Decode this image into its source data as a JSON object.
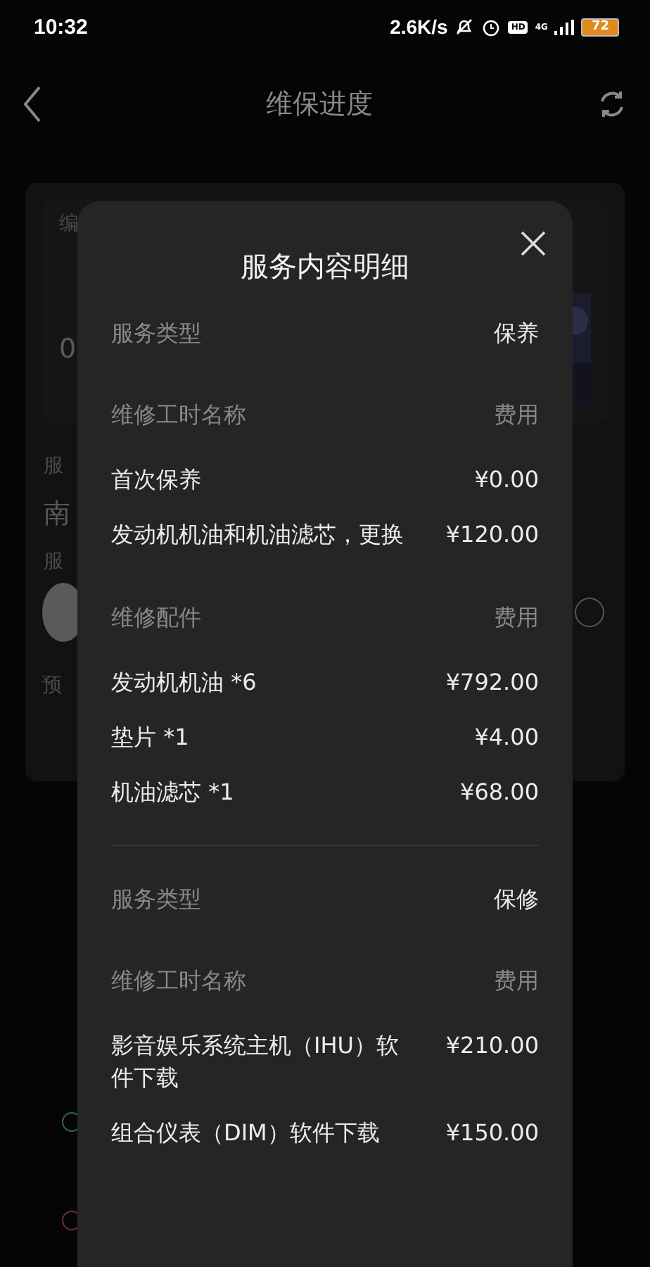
{
  "status_bar": {
    "time": "10:32",
    "net_speed": "2.6K/s",
    "hd_badge": "HD",
    "network": "4G",
    "battery": "72"
  },
  "header": {
    "title": "维保进度"
  },
  "background_card": {
    "code_label": "编",
    "order_digit": "0",
    "service_label": "服",
    "store_name": "南",
    "advisor_label": "服",
    "estimate_label": "预"
  },
  "dialog": {
    "title": "服务内容明细",
    "sections": [
      {
        "type_label": "服务类型",
        "type_value": "保养",
        "groups": [
          {
            "name_header": "维修工时名称",
            "fee_header": "费用",
            "items": [
              {
                "name": "首次保养",
                "price": "¥0.00"
              },
              {
                "name": "发动机机油和机油滤芯，更换",
                "price": "¥120.00"
              }
            ]
          },
          {
            "name_header": "维修配件",
            "fee_header": "费用",
            "items": [
              {
                "name": "发动机机油 *6",
                "price": "¥792.00"
              },
              {
                "name": "垫片 *1",
                "price": "¥4.00"
              },
              {
                "name": "机油滤芯 *1",
                "price": "¥68.00"
              }
            ]
          }
        ]
      },
      {
        "type_label": "服务类型",
        "type_value": "保修",
        "groups": [
          {
            "name_header": "维修工时名称",
            "fee_header": "费用",
            "items": [
              {
                "name": "影音娱乐系统主机（IHU）软件下载",
                "price": "¥210.00"
              },
              {
                "name": "组合仪表（DIM）软件下载",
                "price": "¥150.00"
              }
            ]
          }
        ]
      }
    ]
  }
}
